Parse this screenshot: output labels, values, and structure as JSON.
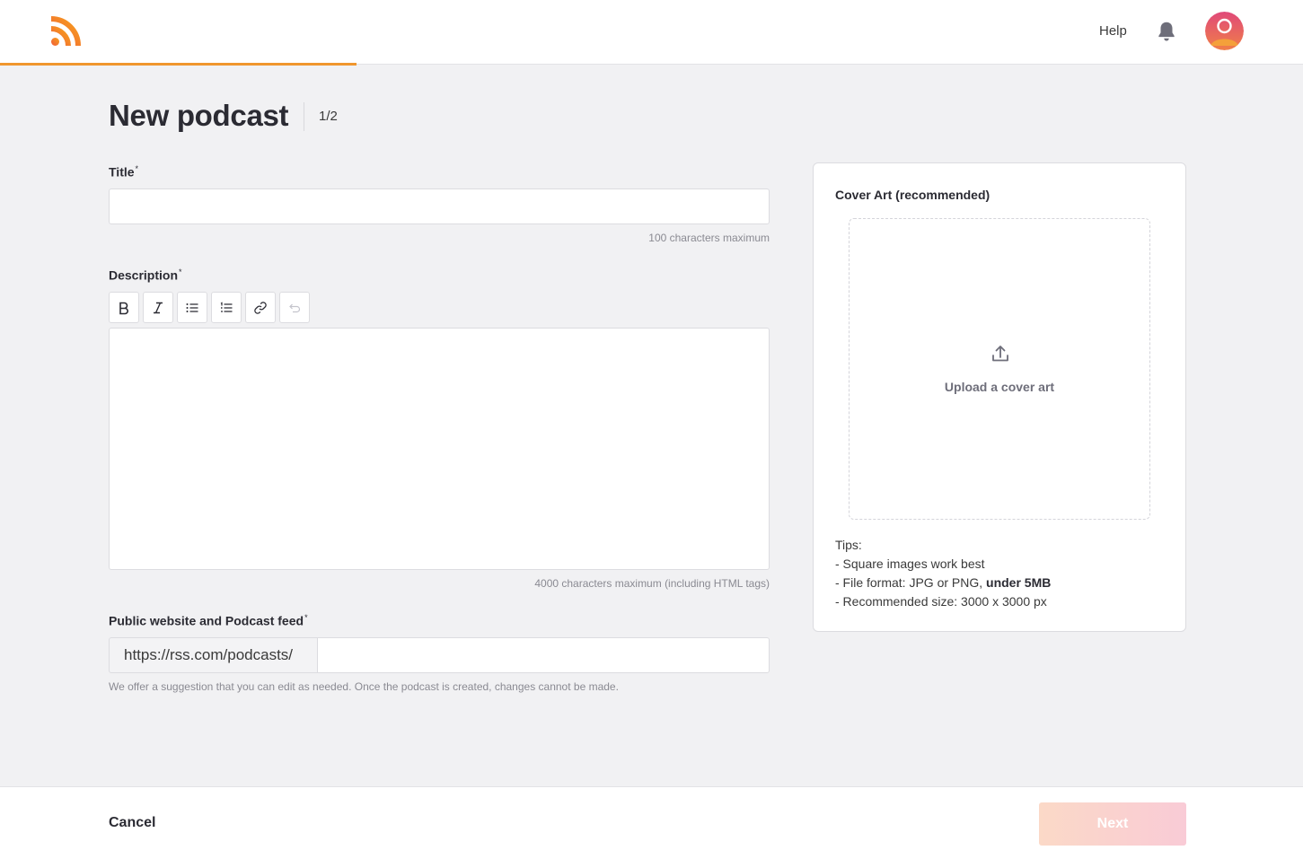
{
  "header": {
    "help_label": "Help",
    "logo_icon": "rss-logo-icon",
    "bell_icon": "bell-icon",
    "avatar_icon": "user-avatar",
    "accent_color": "#f0962e",
    "progress_fraction": 0.27
  },
  "page": {
    "title": "New podcast",
    "step": "1/2"
  },
  "form": {
    "title_label": "Title",
    "title_required_mark": "*",
    "title_value": "",
    "title_hint": "100 characters maximum",
    "description_label": "Description",
    "description_required_mark": "*",
    "description_hint": "4000 characters maximum (including HTML tags)",
    "toolbar": [
      {
        "icon": "bold-icon"
      },
      {
        "icon": "italic-icon"
      },
      {
        "icon": "bullet-list-icon"
      },
      {
        "icon": "numbered-list-icon"
      },
      {
        "icon": "link-icon"
      },
      {
        "icon": "undo-icon",
        "disabled": true
      }
    ],
    "feed_label": "Public website and Podcast feed",
    "feed_required_mark": "*",
    "feed_prefix": "https://rss.com/podcasts/",
    "feed_value": "",
    "feed_hint": "We offer a suggestion that you can edit as needed. Once the podcast is created, changes cannot be made."
  },
  "cover": {
    "title": "Cover Art (recommended)",
    "upload_label": "Upload a cover art",
    "upload_icon": "upload-icon",
    "tips_heading": "Tips:",
    "tip1": "- Square images work best",
    "tip2_prefix": "- File format: JPG or PNG, ",
    "tip2_bold": "under 5MB",
    "tip3": "- Recommended size: 3000 x 3000 px"
  },
  "footer": {
    "cancel_label": "Cancel",
    "next_label": "Next"
  }
}
